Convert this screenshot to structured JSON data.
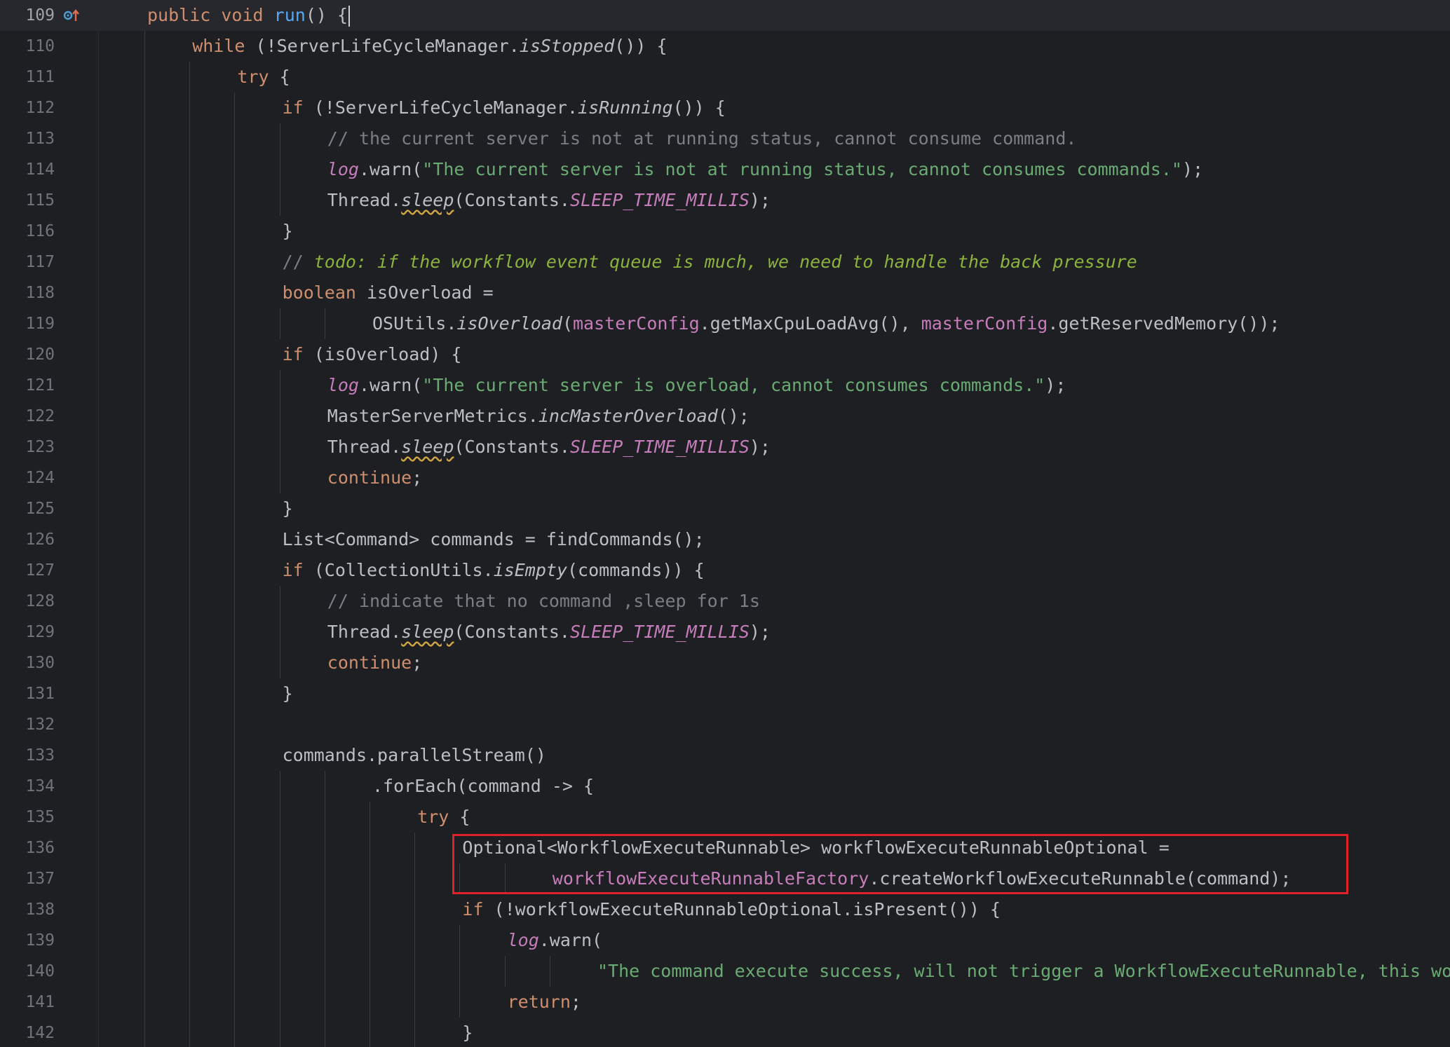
{
  "editor": {
    "lines": [
      {
        "number": "109",
        "tokens": [
          {
            "t": "public",
            "c": "kw"
          },
          {
            "t": " "
          },
          {
            "t": "void",
            "c": "kw"
          },
          {
            "t": " "
          },
          {
            "t": "run",
            "c": "fn"
          },
          {
            "t": "() "
          },
          {
            "t": "{"
          }
        ],
        "indent": 0,
        "current": true,
        "caret": true
      },
      {
        "number": "110",
        "tokens": [
          {
            "t": "while",
            "c": "kw"
          },
          {
            "t": " (!ServerLifeCycleManager."
          },
          {
            "t": "isStopped",
            "c": "it"
          },
          {
            "t": "()) {"
          }
        ],
        "indent": 1
      },
      {
        "number": "111",
        "tokens": [
          {
            "t": "try",
            "c": "kw"
          },
          {
            "t": " {"
          }
        ],
        "indent": 2
      },
      {
        "number": "112",
        "tokens": [
          {
            "t": "if",
            "c": "kw"
          },
          {
            "t": " (!ServerLifeCycleManager."
          },
          {
            "t": "isRunning",
            "c": "it"
          },
          {
            "t": "()) {"
          }
        ],
        "indent": 3
      },
      {
        "number": "113",
        "tokens": [
          {
            "t": "// the current server is not at running status, cannot consume command.",
            "c": "cmt"
          }
        ],
        "indent": 4
      },
      {
        "number": "114",
        "tokens": [
          {
            "t": "log",
            "c": "field it"
          },
          {
            "t": ".warn("
          },
          {
            "t": "\"The current server is not at running status, cannot consumes commands.\"",
            "c": "str"
          },
          {
            "t": ");"
          }
        ],
        "indent": 4
      },
      {
        "number": "115",
        "tokens": [
          {
            "t": "Thread."
          },
          {
            "t": "sleep",
            "c": "it squiggle"
          },
          {
            "t": "(Constants."
          },
          {
            "t": "SLEEP_TIME_MILLIS",
            "c": "field it"
          },
          {
            "t": ");"
          }
        ],
        "indent": 4
      },
      {
        "number": "116",
        "tokens": [
          {
            "t": "}"
          }
        ],
        "indent": 3
      },
      {
        "number": "117",
        "tokens": [
          {
            "t": "// ",
            "c": "cmt"
          },
          {
            "t": "todo: if the workflow event queue is much, we need to handle the back pressure",
            "c": "todo"
          }
        ],
        "indent": 3
      },
      {
        "number": "118",
        "tokens": [
          {
            "t": "boolean",
            "c": "kw"
          },
          {
            "t": " isOverload ="
          }
        ],
        "indent": 3
      },
      {
        "number": "119",
        "tokens": [
          {
            "t": "OSUtils."
          },
          {
            "t": "isOverload",
            "c": "it"
          },
          {
            "t": "("
          },
          {
            "t": "masterConfig",
            "c": "field"
          },
          {
            "t": ".getMaxCpuLoadAvg(), "
          },
          {
            "t": "masterConfig",
            "c": "field"
          },
          {
            "t": ".getReservedMemory());"
          }
        ],
        "indent": 5
      },
      {
        "number": "120",
        "tokens": [
          {
            "t": "if",
            "c": "kw"
          },
          {
            "t": " (isOverload) {"
          }
        ],
        "indent": 3
      },
      {
        "number": "121",
        "tokens": [
          {
            "t": "log",
            "c": "field it"
          },
          {
            "t": ".warn("
          },
          {
            "t": "\"The current server is overload, cannot consumes commands.\"",
            "c": "str"
          },
          {
            "t": ");"
          }
        ],
        "indent": 4
      },
      {
        "number": "122",
        "tokens": [
          {
            "t": "MasterServerMetrics."
          },
          {
            "t": "incMasterOverload",
            "c": "it"
          },
          {
            "t": "();"
          }
        ],
        "indent": 4
      },
      {
        "number": "123",
        "tokens": [
          {
            "t": "Thread."
          },
          {
            "t": "sleep",
            "c": "it squiggle"
          },
          {
            "t": "(Constants."
          },
          {
            "t": "SLEEP_TIME_MILLIS",
            "c": "field it"
          },
          {
            "t": ");"
          }
        ],
        "indent": 4
      },
      {
        "number": "124",
        "tokens": [
          {
            "t": "continue",
            "c": "kw"
          },
          {
            "t": ";"
          }
        ],
        "indent": 4
      },
      {
        "number": "125",
        "tokens": [
          {
            "t": "}"
          }
        ],
        "indent": 3
      },
      {
        "number": "126",
        "tokens": [
          {
            "t": "List<Command> commands = findCommands();"
          }
        ],
        "indent": 3
      },
      {
        "number": "127",
        "tokens": [
          {
            "t": "if",
            "c": "kw"
          },
          {
            "t": " (CollectionUtils."
          },
          {
            "t": "isEmpty",
            "c": "it"
          },
          {
            "t": "(commands)) {"
          }
        ],
        "indent": 3
      },
      {
        "number": "128",
        "tokens": [
          {
            "t": "// indicate that no command ,sleep for 1s",
            "c": "cmt"
          }
        ],
        "indent": 4
      },
      {
        "number": "129",
        "tokens": [
          {
            "t": "Thread."
          },
          {
            "t": "sleep",
            "c": "it squiggle"
          },
          {
            "t": "(Constants."
          },
          {
            "t": "SLEEP_TIME_MILLIS",
            "c": "field it"
          },
          {
            "t": ");"
          }
        ],
        "indent": 4
      },
      {
        "number": "130",
        "tokens": [
          {
            "t": "continue",
            "c": "kw"
          },
          {
            "t": ";"
          }
        ],
        "indent": 4
      },
      {
        "number": "131",
        "tokens": [
          {
            "t": "}"
          }
        ],
        "indent": 3
      },
      {
        "number": "132",
        "tokens": [],
        "indent": 0
      },
      {
        "number": "133",
        "tokens": [
          {
            "t": "commands.parallelStream()"
          }
        ],
        "indent": 3
      },
      {
        "number": "134",
        "tokens": [
          {
            "t": ".forEach(command -> {"
          }
        ],
        "indent": 5
      },
      {
        "number": "135",
        "tokens": [
          {
            "t": "try",
            "c": "kw"
          },
          {
            "t": " {"
          }
        ],
        "indent": 6
      },
      {
        "number": "136",
        "tokens": [
          {
            "t": "Optional<WorkflowExecuteRunnable> workflowExecuteRunnableOptional ="
          }
        ],
        "indent": 7
      },
      {
        "number": "137",
        "tokens": [
          {
            "t": "workflowExecuteRunnableFactory",
            "c": "field"
          },
          {
            "t": ".createWorkflowExecuteRunnable(command);"
          }
        ],
        "indent": 9
      },
      {
        "number": "138",
        "tokens": [
          {
            "t": "if",
            "c": "kw"
          },
          {
            "t": " (!workflowExecuteRunnableOptional.isPresent()) {"
          }
        ],
        "indent": 7
      },
      {
        "number": "139",
        "tokens": [
          {
            "t": "log",
            "c": "field it"
          },
          {
            "t": ".warn("
          }
        ],
        "indent": 8
      },
      {
        "number": "140",
        "tokens": [
          {
            "t": "\"The command execute success, will not trigger a WorkflowExecuteRunnable, this workflowInstance may already running on other master\"",
            "c": "str"
          },
          {
            "t": ");"
          }
        ],
        "indent": 10
      },
      {
        "number": "141",
        "tokens": [
          {
            "t": "return",
            "c": "kw"
          },
          {
            "t": ";"
          }
        ],
        "indent": 8
      },
      {
        "number": "142",
        "tokens": [
          {
            "t": "}"
          }
        ],
        "indent": 7
      }
    ]
  }
}
